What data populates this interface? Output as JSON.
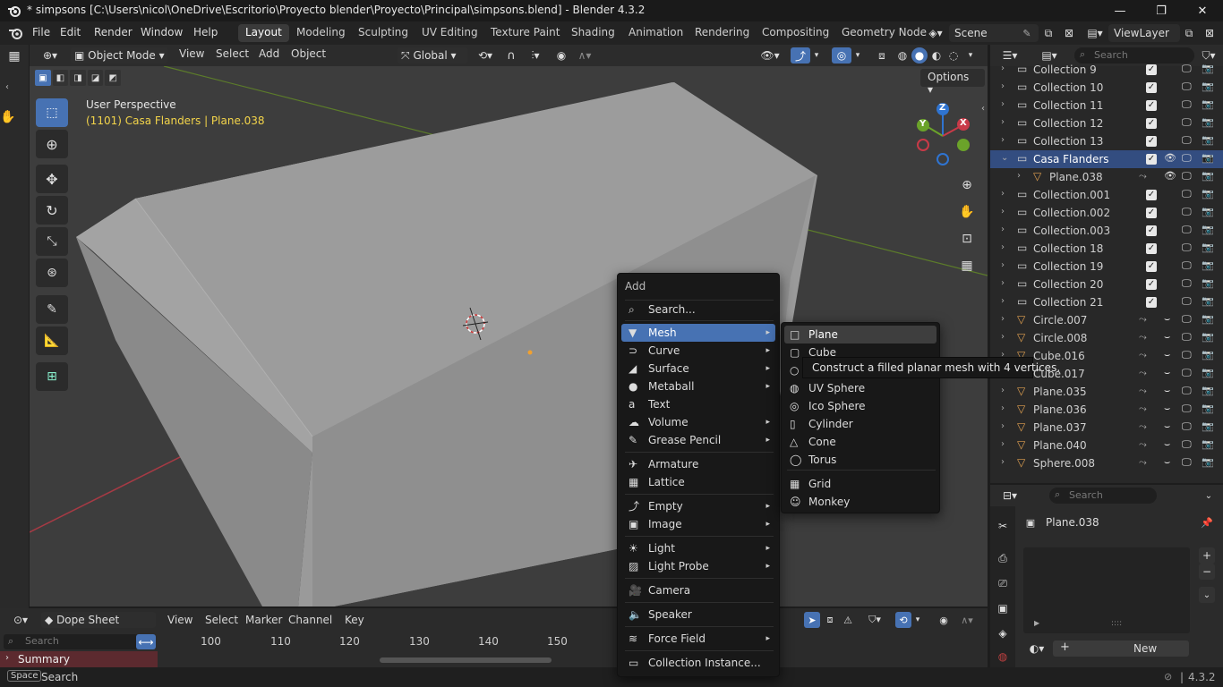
{
  "titlebar": {
    "title": "* simpsons [C:\\Users\\nicol\\OneDrive\\Escritorio\\Proyecto blender\\Proyecto\\Principal\\simpsons.blend] - Blender 4.3.2",
    "minimize": "—",
    "maximize": "❐",
    "close": "✕"
  },
  "menubar": {
    "items": [
      "File",
      "Edit",
      "Render",
      "Window",
      "Help"
    ],
    "workspaces": [
      "Layout",
      "Modeling",
      "Sculpting",
      "UV Editing",
      "Texture Paint",
      "Shading",
      "Animation",
      "Rendering",
      "Compositing",
      "Geometry Node"
    ],
    "active_workspace": "Layout",
    "scene": "Scene",
    "view_layer": "ViewLayer"
  },
  "viewport": {
    "mode": "Object Mode",
    "menus": [
      "View",
      "Select",
      "Add",
      "Object"
    ],
    "transform_orientation": "Global",
    "options": "Options",
    "info_line1": "User Perspective",
    "info_line2": "(1101) Casa Flanders | Plane.038",
    "gizmo": {
      "z": "Z",
      "y": "Y",
      "x": "X"
    },
    "colors": {
      "background": "#3d3d3d",
      "selected_text": "#f3d44a",
      "x_axis": "#c93a48",
      "y_axis": "#6ba32a",
      "z_axis": "#2f74d1"
    }
  },
  "add_menu": {
    "title": "Add",
    "items": [
      {
        "label": "Search...",
        "icon": "search-icon",
        "submenu": false
      },
      {
        "label": "Mesh",
        "icon": "mesh-icon",
        "submenu": true
      },
      {
        "label": "Curve",
        "icon": "curve-icon",
        "submenu": true
      },
      {
        "label": "Surface",
        "icon": "surface-icon",
        "submenu": true
      },
      {
        "label": "Metaball",
        "icon": "metaball-icon",
        "submenu": true
      },
      {
        "label": "Text",
        "icon": "text-icon",
        "submenu": false
      },
      {
        "label": "Volume",
        "icon": "volume-icon",
        "submenu": true
      },
      {
        "label": "Grease Pencil",
        "icon": "grease-pencil-icon",
        "submenu": true
      },
      {
        "label": "Armature",
        "icon": "armature-icon",
        "submenu": false
      },
      {
        "label": "Lattice",
        "icon": "lattice-icon",
        "submenu": false
      },
      {
        "label": "Empty",
        "icon": "empty-icon",
        "submenu": true
      },
      {
        "label": "Image",
        "icon": "image-icon",
        "submenu": true
      },
      {
        "label": "Light",
        "icon": "light-icon",
        "submenu": true
      },
      {
        "label": "Light Probe",
        "icon": "light-probe-icon",
        "submenu": true
      },
      {
        "label": "Camera",
        "icon": "camera-icon",
        "submenu": false
      },
      {
        "label": "Speaker",
        "icon": "speaker-icon",
        "submenu": false
      },
      {
        "label": "Force Field",
        "icon": "force-field-icon",
        "submenu": true
      },
      {
        "label": "Collection Instance...",
        "icon": "collection-icon",
        "submenu": false
      }
    ],
    "highlighted": "Mesh"
  },
  "mesh_submenu": {
    "items": [
      "Plane",
      "Cube",
      "Circle",
      "UV Sphere",
      "Ico Sphere",
      "Cylinder",
      "Cone",
      "Torus",
      "Grid",
      "Monkey"
    ],
    "highlighted": "Plane",
    "tooltip": "Construct a filled planar mesh with 4 vertices."
  },
  "outliner": {
    "search_placeholder": "Search",
    "rows": [
      {
        "name": "Collection 9",
        "type": "collection"
      },
      {
        "name": "Collection 10",
        "type": "collection"
      },
      {
        "name": "Collection 11",
        "type": "collection"
      },
      {
        "name": "Collection 12",
        "type": "collection"
      },
      {
        "name": "Collection 13",
        "type": "collection"
      },
      {
        "name": "Casa Flanders",
        "type": "collection",
        "selected": true
      },
      {
        "name": "Plane.038",
        "type": "mesh",
        "child": true
      },
      {
        "name": "Collection.001",
        "type": "collection"
      },
      {
        "name": "Collection.002",
        "type": "collection"
      },
      {
        "name": "Collection.003",
        "type": "collection"
      },
      {
        "name": "Collection 18",
        "type": "collection"
      },
      {
        "name": "Collection 19",
        "type": "collection"
      },
      {
        "name": "Collection 20",
        "type": "collection"
      },
      {
        "name": "Collection 21",
        "type": "collection"
      },
      {
        "name": "Circle.007",
        "type": "object"
      },
      {
        "name": "Circle.008",
        "type": "object"
      },
      {
        "name": "Cube.016",
        "type": "object"
      },
      {
        "name": "Cube.017",
        "type": "object"
      },
      {
        "name": "Plane.035",
        "type": "object"
      },
      {
        "name": "Plane.036",
        "type": "object"
      },
      {
        "name": "Plane.037",
        "type": "object"
      },
      {
        "name": "Plane.040",
        "type": "object"
      },
      {
        "name": "Sphere.008",
        "type": "object"
      }
    ]
  },
  "properties": {
    "search_placeholder": "Search",
    "object_name": "Plane.038",
    "new_button": "New",
    "plus": "+",
    "minus": "−"
  },
  "timeline": {
    "editor": "Dope Sheet",
    "menus": [
      "View",
      "Select",
      "Marker",
      "Channel",
      "Key"
    ],
    "search_placeholder": "Search",
    "frames": [
      "100",
      "110",
      "120",
      "130",
      "140",
      "150"
    ],
    "summary": "Summary"
  },
  "statusbar": {
    "key": "Space",
    "action": "Search",
    "version": "4.3.2"
  }
}
